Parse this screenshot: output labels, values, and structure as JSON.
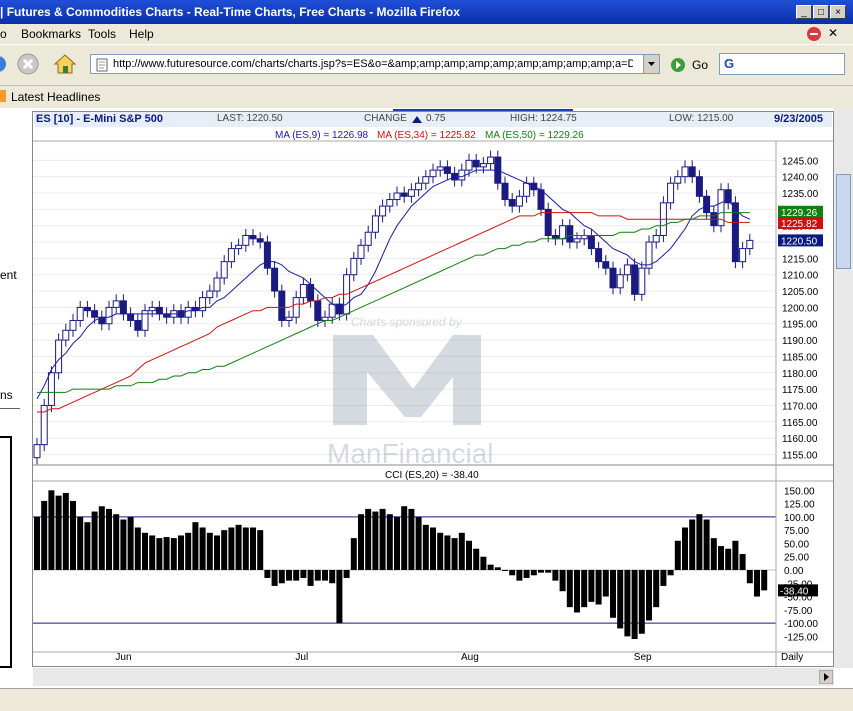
{
  "window": {
    "title": "| Futures & Commodities Charts - Real-Time Charts, Free Charts - Mozilla Firefox"
  },
  "menu": [
    "o",
    "Bookmarks",
    "Tools",
    "Help"
  ],
  "nav": {
    "url": "http://www.futuresource.com/charts/charts.jsp?s=ES&o=&amp;amp;amp;amp;amp;amp;amp;amp;amp;a=Di",
    "go_label": "Go",
    "search_placeholder": "G"
  },
  "bookmarks": {
    "item": "Latest Headlines"
  },
  "left_fragments": [
    "ent",
    "ns"
  ],
  "chart_header": {
    "symbol": "ES [10] - E-Mini S&P 500",
    "last": "LAST: 1220.50",
    "change": "CHANGE",
    "change_value": "0.75",
    "high": "HIGH: 1224.75",
    "low": "LOW: 1215.00",
    "date": "9/23/2005"
  },
  "ma_legend": {
    "ma9": "MA (ES,9) = 1226.98",
    "ma34": "MA (ES,34) = 1225.82",
    "ma50": "MA (ES,50) = 1229.26",
    "colors": {
      "ma9": "#1a1aa6",
      "ma34": "#d01010",
      "ma50": "#108010"
    }
  },
  "watermark": {
    "sponsored": "Charts sponsored by",
    "brand": "ManFinancial"
  },
  "price_tags": {
    "ma50": "1229.26",
    "ma34": "1225.82",
    "last": "1220.50"
  },
  "cci_label": "CCI (ES,20) = -38.40",
  "cci_tag": "-38.40",
  "x_labels": [
    "Jun",
    "Jul",
    "Aug",
    "Sep",
    "Daily"
  ],
  "chart_data": [
    {
      "type": "candlestick",
      "title": "ES [10] - E-Mini S&P 500",
      "y_ticks": [
        1245,
        1240,
        1235,
        1230,
        1225,
        1220,
        1215,
        1210,
        1205,
        1200,
        1195,
        1190,
        1185,
        1180,
        1175,
        1170,
        1165,
        1160,
        1155
      ],
      "ylim": [
        1153,
        1250
      ],
      "closes": [
        1158,
        1170,
        1180,
        1190,
        1193,
        1196,
        1200,
        1199,
        1197,
        1195,
        1200,
        1202,
        1198,
        1196,
        1193,
        1199,
        1200,
        1198,
        1197,
        1199,
        1197,
        1200,
        1199,
        1203,
        1205,
        1209,
        1214,
        1218,
        1219,
        1222,
        1221,
        1220,
        1212,
        1205,
        1196,
        1197,
        1203,
        1207,
        1202,
        1196,
        1197,
        1201,
        1198,
        1210,
        1215,
        1219,
        1223,
        1228,
        1231,
        1233,
        1235,
        1234,
        1236,
        1238,
        1240,
        1242,
        1243,
        1241,
        1239,
        1242,
        1245,
        1243,
        1244,
        1246,
        1238,
        1233,
        1231,
        1234,
        1238,
        1236,
        1230,
        1222,
        1221,
        1225,
        1220,
        1221,
        1222,
        1218,
        1214,
        1212,
        1206,
        1210,
        1213,
        1204,
        1212,
        1220,
        1222,
        1232,
        1238,
        1240,
        1243,
        1240,
        1234,
        1229,
        1225,
        1236,
        1232,
        1214,
        1218,
        1220.5
      ],
      "moving_averages": [
        {
          "name": "MA (ES,9)",
          "values": [
            1172,
            1176,
            1181,
            1184,
            1186,
            1189,
            1191,
            1194,
            1196,
            1197,
            1197,
            1198,
            1198,
            1198,
            1198,
            1198,
            1198,
            1198,
            1198,
            1198,
            1198,
            1199,
            1199,
            1200,
            1200,
            1202,
            1203,
            1205,
            1207,
            1209,
            1211,
            1213,
            1214,
            1214,
            1213,
            1211,
            1210,
            1209,
            1207,
            1205,
            1203,
            1201,
            1200,
            1201,
            1203,
            1204,
            1207,
            1211,
            1216,
            1221,
            1225,
            1228,
            1231,
            1233,
            1235,
            1237,
            1238,
            1239,
            1240,
            1240,
            1241,
            1242,
            1242,
            1242,
            1242,
            1241,
            1240,
            1239,
            1238,
            1237,
            1236,
            1234,
            1232,
            1230,
            1229,
            1227,
            1225,
            1224,
            1222,
            1220,
            1218,
            1217,
            1216,
            1214,
            1213,
            1213,
            1214,
            1216,
            1218,
            1221,
            1224,
            1228,
            1230,
            1231,
            1231,
            1232,
            1233,
            1230,
            1228,
            1227
          ]
        },
        {
          "name": "MA (ES,34)",
          "values": [
            1168,
            1168,
            1169,
            1169,
            1170,
            1171,
            1172,
            1173,
            1174,
            1175,
            1176,
            1177,
            1178,
            1179,
            1181,
            1183,
            1184,
            1185,
            1186,
            1187,
            1188,
            1189,
            1190,
            1191,
            1192,
            1194,
            1195,
            1196,
            1197,
            1198,
            1199,
            1199,
            1200,
            1200,
            1200,
            1200,
            1201,
            1201,
            1202,
            1202,
            1203,
            1203,
            1204,
            1204,
            1205,
            1206,
            1207,
            1208,
            1209,
            1210,
            1211,
            1212,
            1213,
            1214,
            1215,
            1216,
            1217,
            1218,
            1219,
            1220,
            1221,
            1222,
            1223,
            1224,
            1225,
            1226,
            1227,
            1228,
            1228,
            1228,
            1229,
            1229,
            1229,
            1229,
            1229,
            1229,
            1229,
            1229,
            1228,
            1228,
            1228,
            1228,
            1227,
            1227,
            1227,
            1227,
            1227,
            1227,
            1227,
            1227,
            1227,
            1227,
            1227,
            1227,
            1227,
            1227,
            1226,
            1226,
            1226,
            1226
          ]
        },
        {
          "name": "MA (ES,50)",
          "values": [
            1174,
            1174,
            1174,
            1174,
            1174,
            1175,
            1175,
            1175,
            1175,
            1175,
            1175,
            1176,
            1176,
            1176,
            1177,
            1177,
            1177,
            1178,
            1178,
            1179,
            1179,
            1180,
            1180,
            1181,
            1181,
            1182,
            1182,
            1183,
            1184,
            1185,
            1186,
            1187,
            1188,
            1189,
            1190,
            1191,
            1192,
            1193,
            1194,
            1195,
            1196,
            1196,
            1197,
            1198,
            1199,
            1200,
            1201,
            1202,
            1203,
            1204,
            1205,
            1206,
            1207,
            1208,
            1209,
            1210,
            1211,
            1212,
            1213,
            1214,
            1215,
            1216,
            1216,
            1217,
            1218,
            1218,
            1219,
            1219,
            1220,
            1220,
            1221,
            1221,
            1221,
            1221,
            1222,
            1222,
            1222,
            1222,
            1222,
            1222,
            1222,
            1223,
            1223,
            1223,
            1224,
            1224,
            1225,
            1225,
            1226,
            1226,
            1227,
            1227,
            1228,
            1228,
            1228,
            1229,
            1229,
            1229,
            1229,
            1229
          ]
        }
      ]
    },
    {
      "type": "bar",
      "title": "CCI (ES,20) = -38.40",
      "y_ticks": [
        150,
        125,
        100,
        75,
        50,
        25,
        0,
        -25,
        -50,
        -75,
        -100,
        -125
      ],
      "ylim": [
        -145,
        160
      ],
      "reference_lines": [
        100,
        0,
        -100
      ],
      "values": [
        100,
        130,
        150,
        140,
        145,
        130,
        100,
        90,
        110,
        120,
        115,
        105,
        95,
        100,
        80,
        70,
        65,
        60,
        62,
        60,
        65,
        70,
        90,
        80,
        70,
        65,
        75,
        80,
        85,
        80,
        80,
        75,
        -15,
        -30,
        -25,
        -20,
        -20,
        -15,
        -30,
        -20,
        -20,
        -25,
        -100,
        -15,
        60,
        105,
        115,
        110,
        115,
        105,
        100,
        120,
        115,
        100,
        85,
        80,
        70,
        65,
        60,
        70,
        55,
        40,
        25,
        10,
        5,
        0,
        -10,
        -20,
        -15,
        -10,
        -5,
        -5,
        -20,
        -40,
        -70,
        -80,
        -70,
        -60,
        -65,
        -50,
        -90,
        -110,
        -125,
        -130,
        -120,
        -95,
        -70,
        -30,
        -10,
        55,
        80,
        95,
        105,
        95,
        60,
        45,
        40,
        55,
        30,
        -25,
        -50,
        -38.4
      ]
    }
  ]
}
